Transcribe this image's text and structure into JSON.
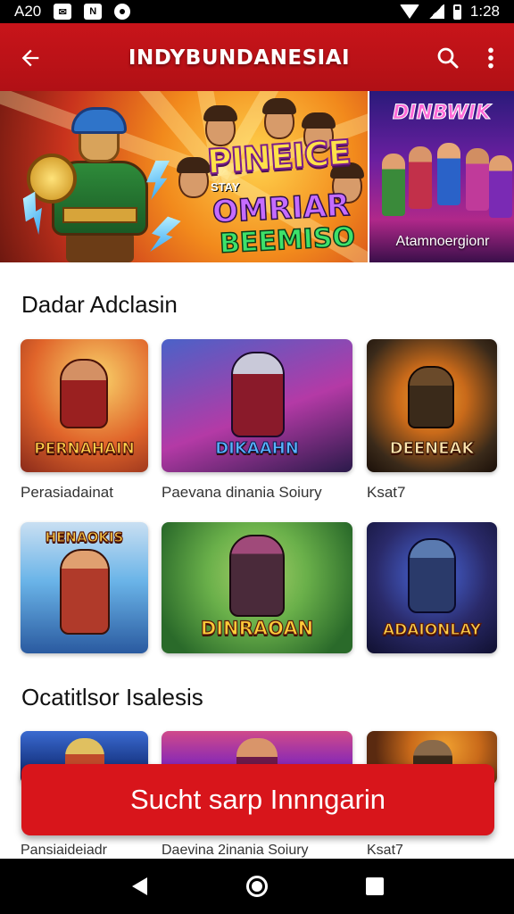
{
  "status_bar": {
    "time": "A20",
    "clock": "1:28"
  },
  "app_bar": {
    "title": "INDYBUNDANESIAI",
    "back_icon": "arrow-left-icon",
    "search_icon": "search-icon",
    "more_icon": "more-vert-icon"
  },
  "banner": {
    "main": {
      "line1": "PINEICE",
      "line2": "STAY",
      "line3": "OMRIAR",
      "line4": "BEEMISO"
    },
    "side": {
      "logo": "DINBWIK",
      "caption": "Atamnoergionr"
    }
  },
  "sections": [
    {
      "title": "Dadar Adclasin",
      "cards": [
        {
          "logo": "PERNAHAIN",
          "caption": "Perasiadainat",
          "colors": [
            "#f3b24a",
            "#e0642a",
            "#8a2a1a"
          ]
        },
        {
          "logo": "DIKAAHN",
          "caption": "Paevana dinania Soiury",
          "colors": [
            "#4a62c8",
            "#b43aa6",
            "#2a1a4a"
          ]
        },
        {
          "logo": "DEENEAK",
          "caption": "Ksat7",
          "colors": [
            "#3a2a1a",
            "#c96a1a",
            "#1a0f08"
          ]
        }
      ]
    },
    {
      "title": "",
      "cards": [
        {
          "logo": "HENAOKIS",
          "caption": "",
          "colors": [
            "#6ab4e8",
            "#2a5aa0",
            "#c9dff2"
          ]
        },
        {
          "logo": "DINRAOAN",
          "caption": "",
          "colors": [
            "#6ab04a",
            "#2a6a2a",
            "#a8d06a"
          ]
        },
        {
          "logo": "ADAIONLAY",
          "caption": "",
          "colors": [
            "#2a2a6a",
            "#4a6ae0",
            "#101030"
          ]
        }
      ]
    },
    {
      "title": "Ocatitlsor Isalesis",
      "cards": [
        {
          "logo": "",
          "caption": "Pansiaideiadr",
          "colors": [
            "#1a3a8a",
            "#3a6ad0",
            "#0a1a4a"
          ]
        },
        {
          "logo": "",
          "caption": "Daevina 2inania Soiury",
          "colors": [
            "#8a2ab4",
            "#d04a8a",
            "#3a1050"
          ]
        },
        {
          "logo": "",
          "caption": "Ksat7",
          "colors": [
            "#c96a1a",
            "#5a2a10",
            "#1a0f08"
          ]
        }
      ]
    }
  ],
  "cta": {
    "label": "Sucht sarp Innngarin"
  },
  "nav_bar": {
    "back_icon": "nav-back-icon",
    "home_icon": "nav-home-icon",
    "recents_icon": "nav-recents-icon"
  }
}
